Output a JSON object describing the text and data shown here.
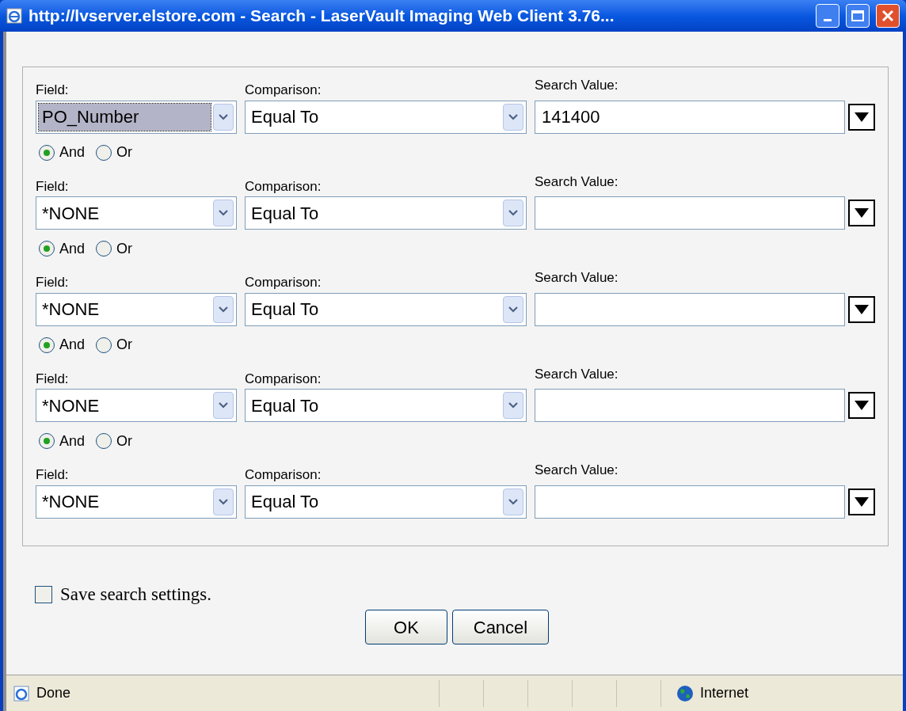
{
  "window": {
    "title": "http://lvserver.elstore.com - Search - LaserVault Imaging Web Client 3.76..."
  },
  "criteria": [
    {
      "field_label": "Field:",
      "field": "PO_Number",
      "field_focused": true,
      "comparison_label": "Comparison:",
      "comparison": "Equal To",
      "value_label": "Search Value:",
      "value": "141400",
      "join": [
        {
          "label": "And",
          "selected": true
        },
        {
          "label": "Or",
          "selected": false
        }
      ]
    },
    {
      "field_label": "Field:",
      "field": "*NONE",
      "field_focused": false,
      "comparison_label": "Comparison:",
      "comparison": "Equal To",
      "value_label": "Search Value:",
      "join": [
        {
          "label": "And",
          "selected": true
        },
        {
          "label": "Or",
          "selected": false
        }
      ]
    },
    {
      "field_label": "Field:",
      "field": "*NONE",
      "field_focused": false,
      "comparison_label": "Comparison:",
      "comparison": "Equal To",
      "value_label": "Search Value:",
      "join": [
        {
          "label": "And",
          "selected": true
        },
        {
          "label": "Or",
          "selected": false
        }
      ]
    },
    {
      "field_label": "Field:",
      "field": "*NONE",
      "field_focused": false,
      "comparison_label": "Comparison:",
      "comparison": "Equal To",
      "value_label": "Search Value:",
      "join": [
        {
          "label": "And",
          "selected": true
        },
        {
          "label": "Or",
          "selected": false
        }
      ]
    },
    {
      "field_label": "Field:",
      "field": "*NONE",
      "field_focused": false,
      "comparison_label": "Comparison:",
      "comparison": "Equal To",
      "value_label": "Search Value:"
    }
  ],
  "save_settings": {
    "label": "Save search settings.",
    "checked": false
  },
  "buttons": [
    "OK",
    "Cancel"
  ],
  "status_bar": {
    "status": "Done",
    "zone": "Internet"
  }
}
